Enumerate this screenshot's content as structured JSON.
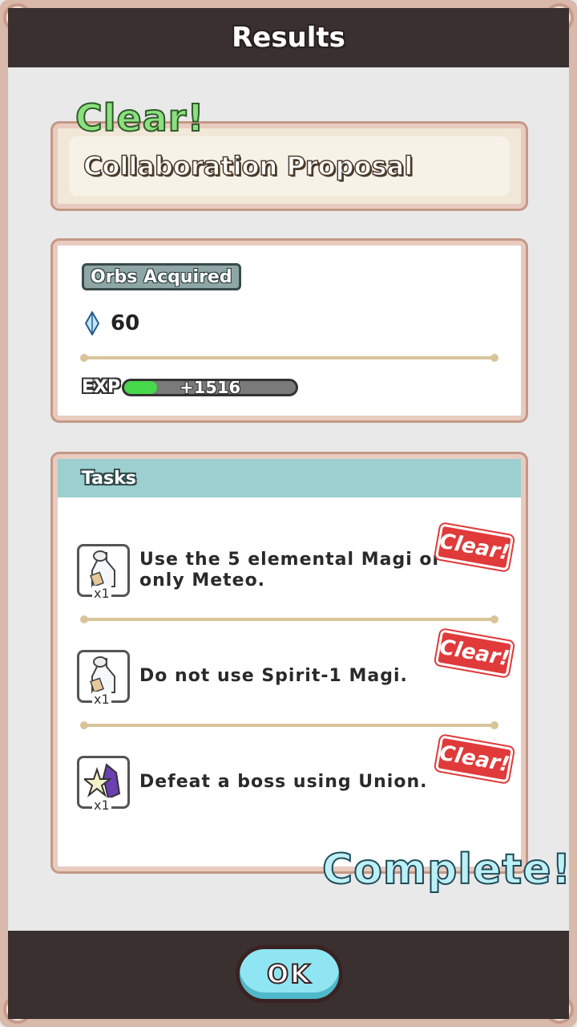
{
  "header": {
    "title": "Results"
  },
  "result": {
    "status": "Clear!",
    "quest_name": "Collaboration Proposal"
  },
  "rewards": {
    "orbs_label": "Orbs Acquired",
    "orb_icon": "orb-crystal-icon",
    "orbs_value": "60",
    "exp_label": "EXP",
    "exp_gain": "+1516",
    "exp_fill_fraction": 0.19
  },
  "tasks": {
    "header": "Tasks",
    "items": [
      {
        "text_line1": "Use the 5 elemental Magi or",
        "text_line2": "only Meteo.",
        "quantity": "x1",
        "stamp": "Clear!",
        "icon": "potion-bottle-icon"
      },
      {
        "text_line1": "Do not use Spirit-1 Magi.",
        "text_line2": "",
        "quantity": "x1",
        "stamp": "Clear!",
        "icon": "potion-bottle-icon"
      },
      {
        "text_line1": "Defeat a boss using Union.",
        "text_line2": "",
        "quantity": "x1",
        "stamp": "Clear!",
        "icon": "star-cape-icon"
      }
    ],
    "complete_label": "Complete!"
  },
  "footer": {
    "ok_label": "OK"
  },
  "colors": {
    "bar": "#3a3030",
    "accent_teal": "#9ccfcf",
    "clear_red": "#e03a3a",
    "exp_green": "#47d94b"
  }
}
